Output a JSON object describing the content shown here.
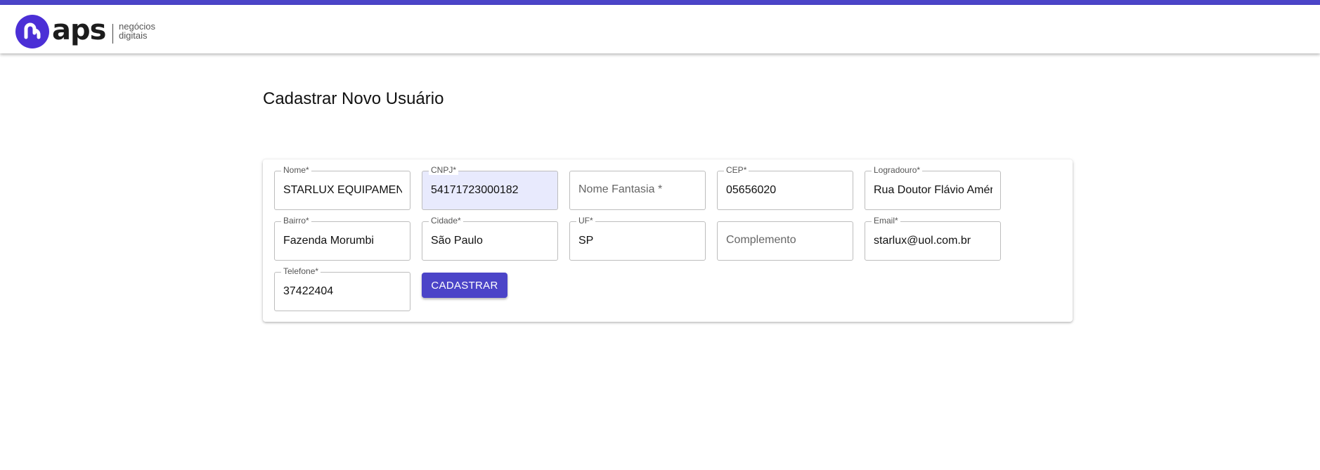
{
  "brand": {
    "name": "aps",
    "subtitle_line1": "negócios",
    "subtitle_line2": "digitais",
    "logo_icon": "aps-logo-icon",
    "accent_color": "#4b44c8"
  },
  "page": {
    "title": "Cadastrar Novo Usuário"
  },
  "form": {
    "nome": {
      "label": "Nome",
      "value": "STARLUX EQUIPAMENTOS"
    },
    "cnpj": {
      "label": "CNPJ",
      "value": "54171723000182"
    },
    "nome_fantasia": {
      "label": "Nome Fantasia",
      "placeholder": "Nome Fantasia",
      "value": ""
    },
    "cep": {
      "label": "CEP",
      "value": "05656020"
    },
    "logradouro": {
      "label": "Logradouro",
      "value": "Rua Doutor Flávio Américo"
    },
    "bairro": {
      "label": "Bairro",
      "value": "Fazenda Morumbi"
    },
    "cidade": {
      "label": "Cidade",
      "value": "São Paulo"
    },
    "uf": {
      "label": "UF",
      "value": "SP"
    },
    "complemento": {
      "label": "Complemento",
      "placeholder": "Complemento",
      "value": ""
    },
    "email": {
      "label": "Email",
      "value": "starlux@uol.com.br"
    },
    "telefone": {
      "label": "Telefone",
      "value": "37422404"
    },
    "required_marker": "*",
    "submit_label": "CADASTRAR"
  }
}
